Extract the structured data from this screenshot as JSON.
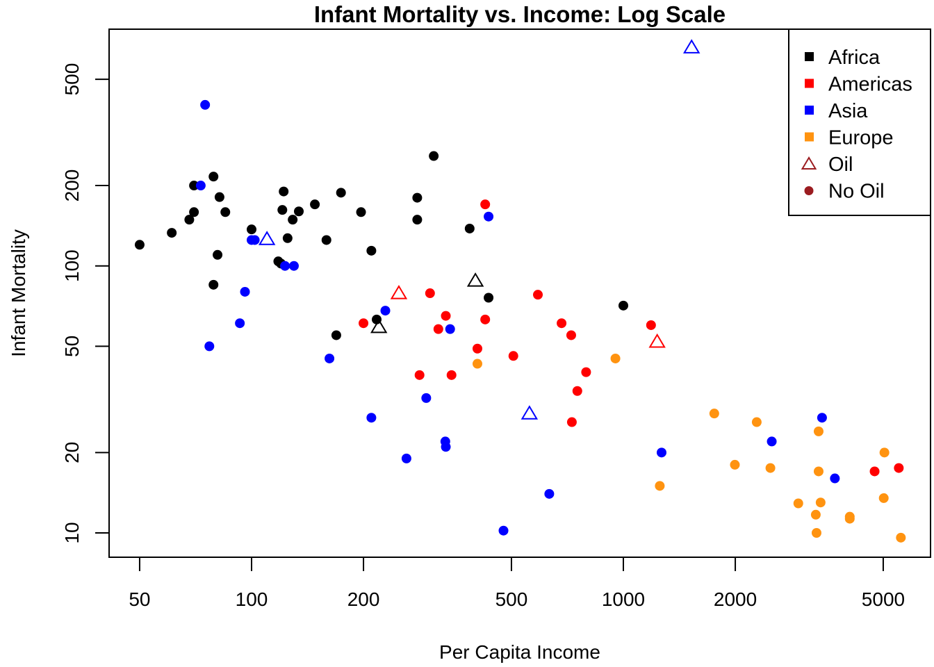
{
  "chart_data": {
    "type": "scatter",
    "title": "Infant Mortality vs. Income: Log Scale",
    "xlabel": "Per Capita Income",
    "ylabel": "Infant Mortality",
    "x_scale": "log",
    "y_scale": "log",
    "xlim": [
      47,
      5900
    ],
    "ylim": [
      8.1,
      780
    ],
    "x_ticks": [
      50,
      100,
      200,
      500,
      1000,
      2000,
      5000
    ],
    "x_tick_labels": [
      "50",
      "100",
      "200",
      "500",
      "1000",
      "2000",
      "5000"
    ],
    "y_ticks": [
      10,
      20,
      50,
      100,
      200,
      500
    ],
    "y_tick_labels": [
      "10",
      "20",
      "50",
      "100",
      "200",
      "500"
    ],
    "grid": false,
    "legend": {
      "position": "top-right",
      "entries": [
        {
          "label": "Africa",
          "symbol": "square",
          "color": "#000000"
        },
        {
          "label": "Americas",
          "symbol": "square",
          "color": "#ff0000"
        },
        {
          "label": "Asia",
          "symbol": "square",
          "color": "#0000ff"
        },
        {
          "label": "Europe",
          "symbol": "square",
          "color": "#ff9310"
        },
        {
          "label": "Oil",
          "symbol": "triangle-open",
          "color": "#9b1c20"
        },
        {
          "label": "No Oil",
          "symbol": "circle",
          "color": "#9b1c20"
        }
      ]
    },
    "region_colors": {
      "Africa": "#000000",
      "Americas": "#ff0000",
      "Asia": "#0000ff",
      "Europe": "#ff9310"
    },
    "series": [
      {
        "name": "Africa",
        "points": [
          {
            "x": 50,
            "y": 120,
            "oil": false
          },
          {
            "x": 61,
            "y": 133,
            "oil": false
          },
          {
            "x": 68,
            "y": 149,
            "oil": false
          },
          {
            "x": 70,
            "y": 159,
            "oil": false
          },
          {
            "x": 70,
            "y": 200,
            "oil": false
          },
          {
            "x": 79,
            "y": 216,
            "oil": false
          },
          {
            "x": 82,
            "y": 181,
            "oil": false
          },
          {
            "x": 85,
            "y": 159,
            "oil": false
          },
          {
            "x": 81,
            "y": 110,
            "oil": false
          },
          {
            "x": 79,
            "y": 85,
            "oil": false
          },
          {
            "x": 100,
            "y": 137,
            "oil": false
          },
          {
            "x": 118,
            "y": 104,
            "oil": false
          },
          {
            "x": 120,
            "y": 102,
            "oil": false
          },
          {
            "x": 122,
            "y": 190,
            "oil": false
          },
          {
            "x": 121,
            "y": 162,
            "oil": false
          },
          {
            "x": 125,
            "y": 127,
            "oil": false
          },
          {
            "x": 129,
            "y": 149,
            "oil": false
          },
          {
            "x": 134,
            "y": 160,
            "oil": false
          },
          {
            "x": 148,
            "y": 170,
            "oil": false
          },
          {
            "x": 159,
            "y": 125,
            "oil": false
          },
          {
            "x": 174,
            "y": 188,
            "oil": false
          },
          {
            "x": 197,
            "y": 159,
            "oil": false
          },
          {
            "x": 210,
            "y": 114,
            "oil": false
          },
          {
            "x": 169,
            "y": 55,
            "oil": false
          },
          {
            "x": 217,
            "y": 63,
            "oil": false
          },
          {
            "x": 220,
            "y": 59,
            "oil": true
          },
          {
            "x": 279,
            "y": 180,
            "oil": false
          },
          {
            "x": 279,
            "y": 149,
            "oil": false
          },
          {
            "x": 309,
            "y": 258,
            "oil": false
          },
          {
            "x": 386,
            "y": 138,
            "oil": false
          },
          {
            "x": 400,
            "y": 88,
            "oil": true
          },
          {
            "x": 434,
            "y": 76,
            "oil": false
          },
          {
            "x": 1000,
            "y": 71,
            "oil": false
          }
        ]
      },
      {
        "name": "Americas",
        "points": [
          {
            "x": 200,
            "y": 61,
            "oil": false
          },
          {
            "x": 249,
            "y": 79,
            "oil": true
          },
          {
            "x": 283,
            "y": 39,
            "oil": false
          },
          {
            "x": 302,
            "y": 79,
            "oil": false
          },
          {
            "x": 318,
            "y": 58,
            "oil": false
          },
          {
            "x": 333,
            "y": 65,
            "oil": false
          },
          {
            "x": 345,
            "y": 39,
            "oil": false
          },
          {
            "x": 405,
            "y": 49,
            "oil": false
          },
          {
            "x": 425,
            "y": 170,
            "oil": false
          },
          {
            "x": 425,
            "y": 63,
            "oil": false
          },
          {
            "x": 506,
            "y": 46,
            "oil": false
          },
          {
            "x": 589,
            "y": 78,
            "oil": false
          },
          {
            "x": 682,
            "y": 61,
            "oil": false
          },
          {
            "x": 724,
            "y": 55,
            "oil": false
          },
          {
            "x": 727,
            "y": 26,
            "oil": false
          },
          {
            "x": 752,
            "y": 34,
            "oil": false
          },
          {
            "x": 794,
            "y": 40,
            "oil": false
          },
          {
            "x": 1187,
            "y": 60,
            "oil": false
          },
          {
            "x": 1233,
            "y": 52,
            "oil": true
          },
          {
            "x": 4740,
            "y": 17,
            "oil": false
          },
          {
            "x": 5506,
            "y": 17.5,
            "oil": false
          }
        ]
      },
      {
        "name": "Asia",
        "points": [
          {
            "x": 73,
            "y": 200,
            "oil": false
          },
          {
            "x": 75,
            "y": 401,
            "oil": false
          },
          {
            "x": 77,
            "y": 50,
            "oil": false
          },
          {
            "x": 93,
            "y": 61,
            "oil": false
          },
          {
            "x": 96,
            "y": 80,
            "oil": false
          },
          {
            "x": 100,
            "y": 125,
            "oil": false
          },
          {
            "x": 102,
            "y": 125,
            "oil": false
          },
          {
            "x": 110,
            "y": 126,
            "oil": true
          },
          {
            "x": 123,
            "y": 100,
            "oil": false
          },
          {
            "x": 130,
            "y": 100,
            "oil": false
          },
          {
            "x": 162,
            "y": 45,
            "oil": false
          },
          {
            "x": 210,
            "y": 27,
            "oil": false
          },
          {
            "x": 229,
            "y": 68,
            "oil": false
          },
          {
            "x": 261,
            "y": 19,
            "oil": false
          },
          {
            "x": 295,
            "y": 32,
            "oil": false
          },
          {
            "x": 332,
            "y": 22,
            "oil": false
          },
          {
            "x": 333,
            "y": 21,
            "oil": false
          },
          {
            "x": 342,
            "y": 58,
            "oil": false
          },
          {
            "x": 434,
            "y": 153,
            "oil": false
          },
          {
            "x": 476,
            "y": 10.2,
            "oil": false
          },
          {
            "x": 559,
            "y": 28,
            "oil": true
          },
          {
            "x": 632,
            "y": 14,
            "oil": false
          },
          {
            "x": 1267,
            "y": 20,
            "oil": false
          },
          {
            "x": 1526,
            "y": 658,
            "oil": true
          },
          {
            "x": 2507,
            "y": 22,
            "oil": false
          },
          {
            "x": 3423,
            "y": 27,
            "oil": false
          },
          {
            "x": 3706,
            "y": 16,
            "oil": false
          }
        ]
      },
      {
        "name": "Europe",
        "points": [
          {
            "x": 405,
            "y": 43,
            "oil": false
          },
          {
            "x": 952,
            "y": 45,
            "oil": false
          },
          {
            "x": 1253,
            "y": 15,
            "oil": false
          },
          {
            "x": 1756,
            "y": 28,
            "oil": false
          },
          {
            "x": 1995,
            "y": 18,
            "oil": false
          },
          {
            "x": 2284,
            "y": 26,
            "oil": false
          },
          {
            "x": 2486,
            "y": 17.5,
            "oil": false
          },
          {
            "x": 2955,
            "y": 12.9,
            "oil": false
          },
          {
            "x": 3293,
            "y": 11.7,
            "oil": false
          },
          {
            "x": 3308,
            "y": 10,
            "oil": false
          },
          {
            "x": 3351,
            "y": 24,
            "oil": false
          },
          {
            "x": 3351,
            "y": 17,
            "oil": false
          },
          {
            "x": 3393,
            "y": 13,
            "oil": false
          },
          {
            "x": 4064,
            "y": 11.5,
            "oil": false
          },
          {
            "x": 4064,
            "y": 11.3,
            "oil": false
          },
          {
            "x": 5016,
            "y": 13.5,
            "oil": false
          },
          {
            "x": 5037,
            "y": 20,
            "oil": false
          },
          {
            "x": 5577,
            "y": 9.6,
            "oil": false
          }
        ]
      }
    ]
  }
}
